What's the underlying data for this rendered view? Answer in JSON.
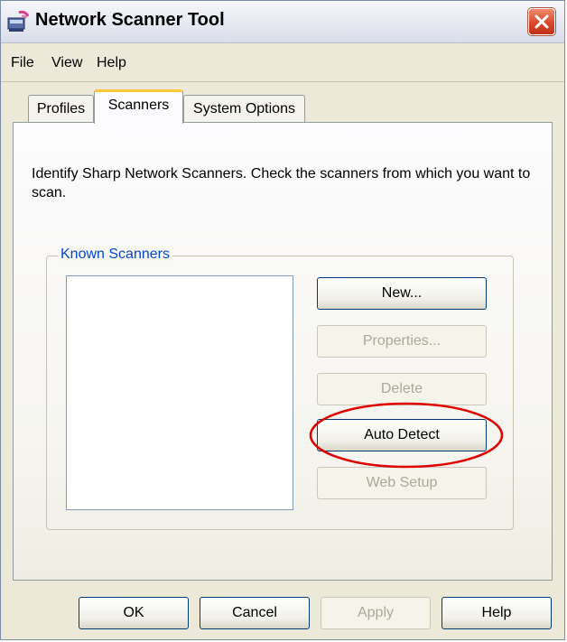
{
  "window": {
    "title": "Network Scanner Tool",
    "accent": "#ffc83c",
    "close_color": "#d8492c",
    "highlight_color": "#e00000"
  },
  "menu": [
    {
      "label": "File"
    },
    {
      "label": "View"
    },
    {
      "label": "Help"
    }
  ],
  "tabs": [
    {
      "label": "Profiles",
      "active": false
    },
    {
      "label": "Scanners",
      "active": true
    },
    {
      "label": "System Options",
      "active": false
    }
  ],
  "instructions": "Identify Sharp Network Scanners. Check the scanners from which you want to scan.",
  "known_scanners": {
    "label": "Known Scanners",
    "items": [],
    "buttons": [
      {
        "label": "New...",
        "enabled": true
      },
      {
        "label": "Properties...",
        "enabled": false
      },
      {
        "label": "Delete",
        "enabled": false
      },
      {
        "label": "Auto Detect",
        "enabled": true,
        "highlighted": true
      },
      {
        "label": "Web Setup",
        "enabled": false
      }
    ]
  },
  "footer_buttons": [
    {
      "label": "OK",
      "enabled": true
    },
    {
      "label": "Cancel",
      "enabled": true
    },
    {
      "label": "Apply",
      "enabled": false
    },
    {
      "label": "Help",
      "enabled": true
    }
  ],
  "icons": {
    "app": "scanner-app-icon",
    "close": "close-icon"
  }
}
